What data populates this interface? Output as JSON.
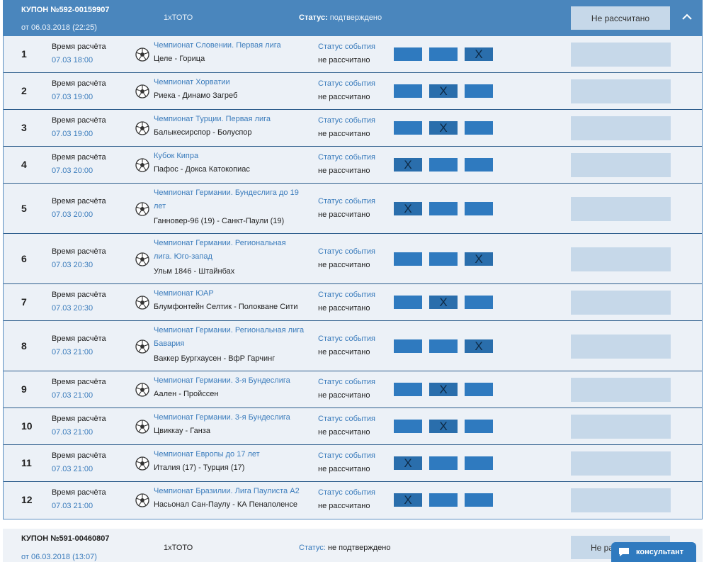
{
  "coupon1": {
    "number": "КУПОН №592-00159907",
    "date": "от 06.03.2018 (22:25)",
    "type": "1xТОТО",
    "status_label": "Статус:",
    "status_value": "подтверждено",
    "calc_button": "Не рассчитано",
    "collapse_icon": "chevron-up-icon",
    "time_label": "Время расчёта",
    "event_status_label": "Статус события",
    "event_status_value": "не рассчитано",
    "option_selected_mark": "X",
    "events": [
      {
        "n": "1",
        "time": "07.03 18:00",
        "league": "Чемпионат Словении. Первая лига",
        "teams": "Целе - Горица",
        "sel": 2
      },
      {
        "n": "2",
        "time": "07.03 19:00",
        "league": "Чемпионат Хорватии",
        "teams": "Риека - Динамо Загреб",
        "sel": 1
      },
      {
        "n": "3",
        "time": "07.03 19:00",
        "league": "Чемпионат Турции. Первая лига",
        "teams": "Балыкесирспор - Болуспор",
        "sel": 1
      },
      {
        "n": "4",
        "time": "07.03 20:00",
        "league": "Кубок Кипра",
        "teams": "Пафос - Докса Катокопиас",
        "sel": 0
      },
      {
        "n": "5",
        "time": "07.03 20:00",
        "league": "Чемпионат Германии. Бундеслига до 19 лет",
        "teams": "Ганновер-96 (19) - Санкт-Паули (19)",
        "sel": 0
      },
      {
        "n": "6",
        "time": "07.03 20:30",
        "league": "Чемпионат Германии. Региональная лига. Юго-запад",
        "teams": "Ульм 1846 - Штайнбах",
        "sel": 2
      },
      {
        "n": "7",
        "time": "07.03 20:30",
        "league": "Чемпионат ЮАР",
        "teams": "Блумфонтейн Селтик - Полокване Сити",
        "sel": 1
      },
      {
        "n": "8",
        "time": "07.03 21:00",
        "league": "Чемпионат Германии. Региональная лига Бавария",
        "teams": "Ваккер Бургхаусен - ВфР Гарчинг",
        "sel": 2
      },
      {
        "n": "9",
        "time": "07.03 21:00",
        "league": "Чемпионат Германии. 3-я Бундеслига",
        "teams": "Аален - Пройссен",
        "sel": 1
      },
      {
        "n": "10",
        "time": "07.03 21:00",
        "league": "Чемпионат Германии. 3-я Бундеслига",
        "teams": "Цвиккау - Ганза",
        "sel": 1
      },
      {
        "n": "11",
        "time": "07.03 21:00",
        "league": "Чемпионат Европы до 17 лет",
        "teams": "Италия (17) - Турция (17)",
        "sel": 0
      },
      {
        "n": "12",
        "time": "07.03 21:00",
        "league": "Чемпионат Бразилии. Лига Паулиста А2",
        "teams": "Насьонал Сан-Паулу - КА Пенаполенсе",
        "sel": 0
      }
    ]
  },
  "coupon2": {
    "number": "КУПОН №591-00460807",
    "date": "от 06.03.2018 (13:07)",
    "type": "1xТОТО",
    "status_label": "Статус:",
    "status_value": "не подтверждено",
    "calc_button": "Не ра"
  },
  "consultant": {
    "label": "консультант",
    "icon": "chat-icon"
  },
  "colors": {
    "header_bg": "#4a86bd",
    "option_bg": "#2f7abf",
    "result_bg": "#c6d8e9",
    "row_bg": "#ecf1f7",
    "link": "#3b7cbc"
  }
}
